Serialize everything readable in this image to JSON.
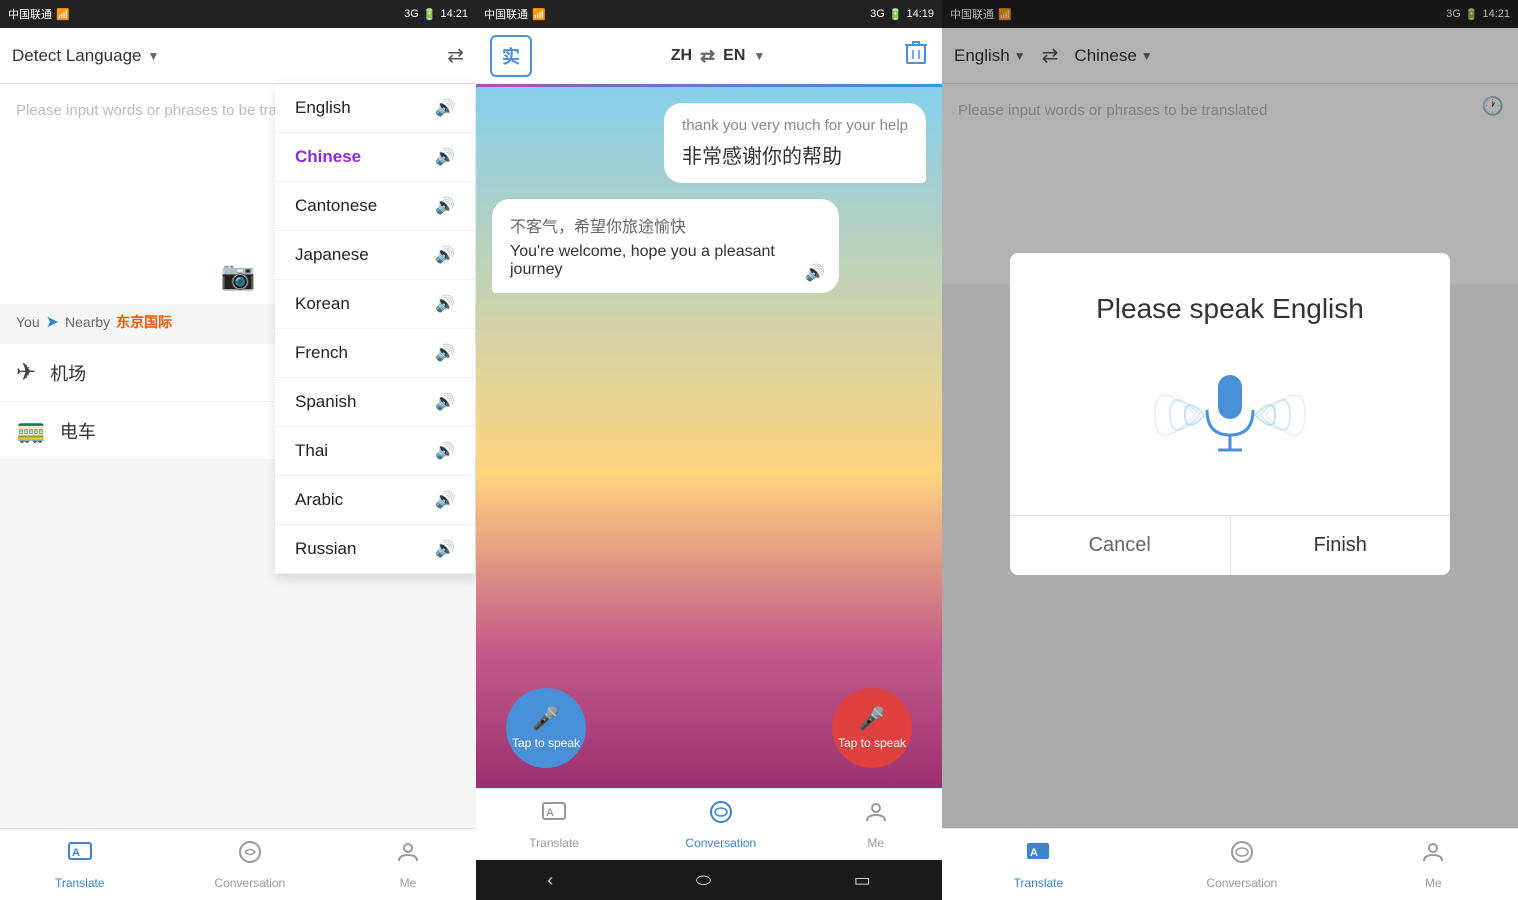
{
  "screen1": {
    "statusBar": {
      "carrier": "中国联通",
      "time": "14:21",
      "signal": "3G"
    },
    "header": {
      "detectLabel": "Detect Language",
      "swapIcon": "⇄"
    },
    "inputPlaceholder": "Please input words or phrases to be translated",
    "cameraIcon": "📷",
    "nearby": {
      "label": "You",
      "nearbyLabel": "Nearby",
      "place": "东京国际"
    },
    "quickItems": [
      {
        "icon": "✈",
        "label": "机场"
      },
      {
        "icon": "🚃",
        "label": "电车"
      }
    ],
    "dropdown": {
      "selectedLang": "Chinese",
      "items": [
        {
          "label": "English",
          "selected": false
        },
        {
          "label": "Chinese",
          "selected": true
        },
        {
          "label": "Cantonese",
          "selected": false
        },
        {
          "label": "Japanese",
          "selected": false
        },
        {
          "label": "Korean",
          "selected": false
        },
        {
          "label": "French",
          "selected": false
        },
        {
          "label": "Spanish",
          "selected": false
        },
        {
          "label": "Thai",
          "selected": false
        },
        {
          "label": "Arabic",
          "selected": false
        },
        {
          "label": "Russian",
          "selected": false
        }
      ]
    },
    "bottomNav": [
      {
        "label": "Translate",
        "active": true
      },
      {
        "label": "Conversation",
        "active": false
      },
      {
        "label": "Me",
        "active": false
      }
    ]
  },
  "screen2": {
    "statusBar": {
      "carrier": "中国联通",
      "time": "14:19",
      "signal": "3G"
    },
    "header": {
      "realtimeLabel": "实",
      "langFrom": "ZH",
      "swapIcon": "⇄",
      "langTo": "EN",
      "trashIcon": "🗑"
    },
    "conversation": [
      {
        "side": "right",
        "lineEn": "thank you very much for your help",
        "lineZh": "非常感谢你的帮助"
      },
      {
        "side": "left",
        "lineZh": "不客气，希望你旅途愉快",
        "lineEn": "You're welcome, hope you a pleasant journey"
      }
    ],
    "speakBtns": [
      {
        "label": "Tap to speak",
        "color": "blue"
      },
      {
        "label": "Tap to speak",
        "color": "red"
      }
    ],
    "bottomNav": [
      {
        "label": "Translate",
        "active": false
      },
      {
        "label": "Conversation",
        "active": true
      },
      {
        "label": "Me",
        "active": false
      }
    ]
  },
  "screen3": {
    "statusBar": {
      "carrier": "中国联通",
      "time": "14:21",
      "signal": "3G"
    },
    "header": {
      "langFrom": "English",
      "swapIcon": "⇄",
      "langTo": "Chinese"
    },
    "inputPlaceholder": "Please input words or phrases to be translated",
    "modal": {
      "title": "Please speak English",
      "cancelLabel": "Cancel",
      "finishLabel": "Finish"
    },
    "bottomNav": [
      {
        "label": "Translate",
        "active": true
      },
      {
        "label": "Conversation",
        "active": false
      },
      {
        "label": "Me",
        "active": false
      }
    ]
  }
}
